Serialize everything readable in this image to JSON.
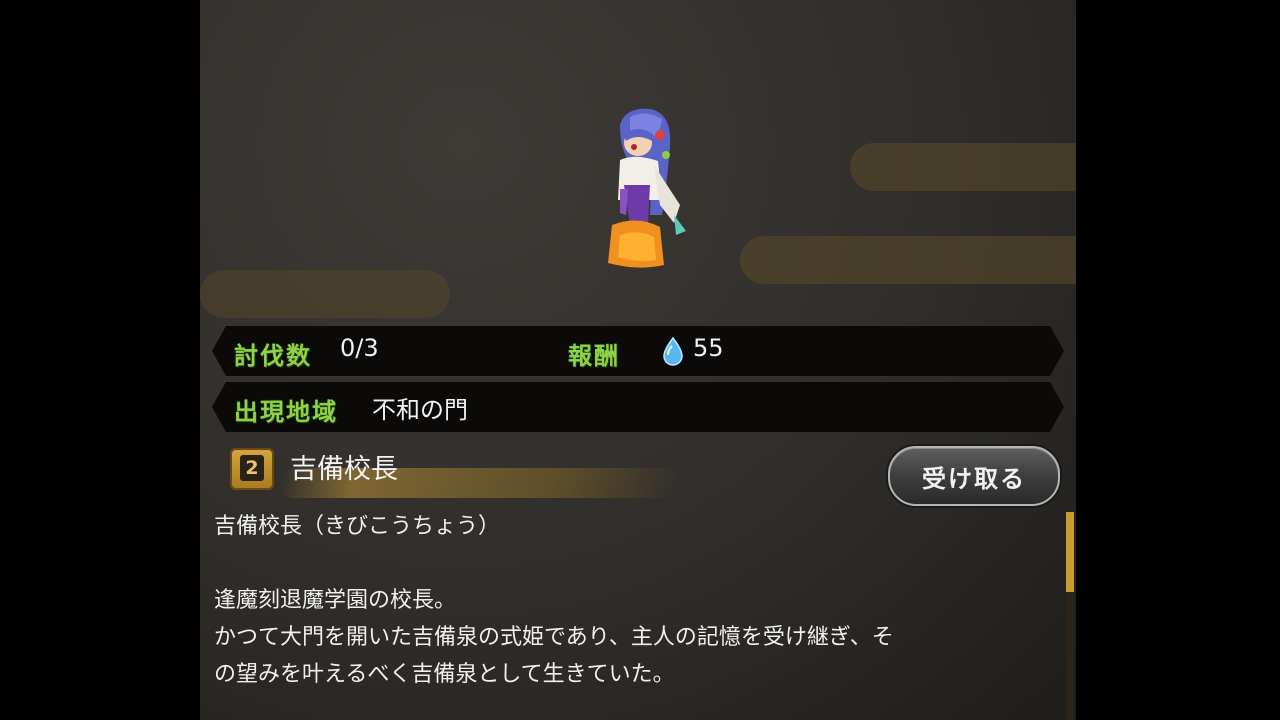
{
  "info": {
    "kill_label": "討伐数",
    "kill_value": "0/3",
    "reward_label": "報酬",
    "reward_icon": "water-drop-icon",
    "reward_value": "55",
    "area_label": "出現地域",
    "area_value": "不和の門"
  },
  "character": {
    "number": "2",
    "name": "吉備校長"
  },
  "receive_button": "受け取る",
  "description": {
    "line1": "吉備校長（きびこうちょう）",
    "line2": "逢魔刻退魔学園の校長。",
    "line3": "かつて大門を開いた吉備泉の式姫であり、主人の記憶を受け継ぎ、そ",
    "line4": "の望みを叶えるべく吉備泉として生きていた。"
  },
  "colors": {
    "label_green": "#8fd24a",
    "accent_gold": "#c99a2e"
  }
}
